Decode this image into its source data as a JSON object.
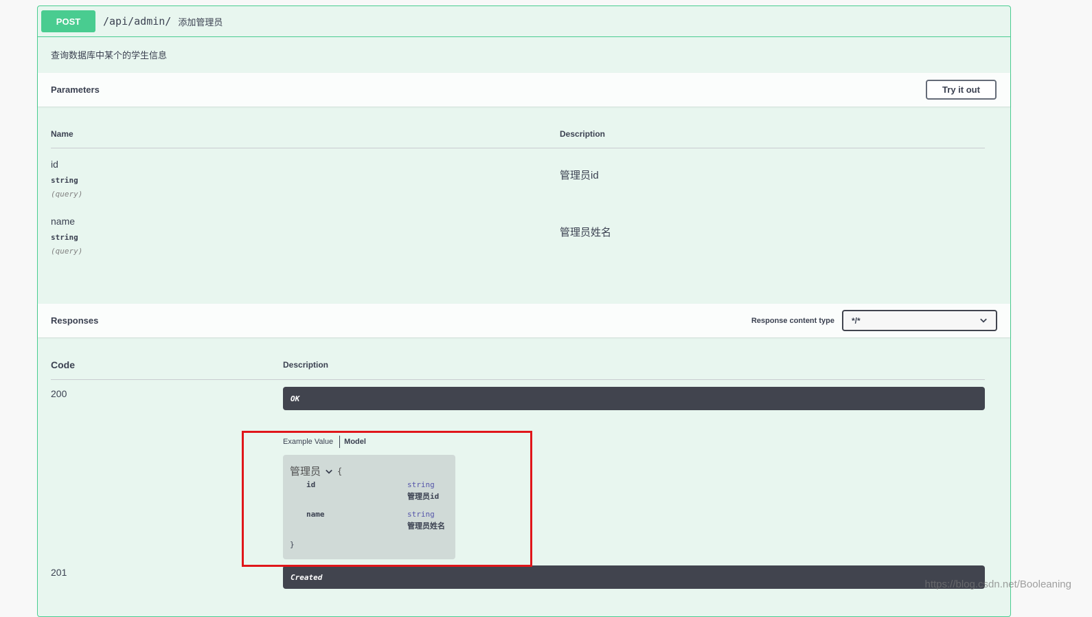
{
  "endpoint": {
    "method": "POST",
    "path": "/api/admin/",
    "summary": "添加管理员",
    "description": "查询数据库中某个的学生信息"
  },
  "parameters": {
    "title": "Parameters",
    "try_button": "Try it out",
    "col_name": "Name",
    "col_description": "Description",
    "items": [
      {
        "name": "id",
        "type": "string",
        "in": "(query)",
        "description": "管理员id"
      },
      {
        "name": "name",
        "type": "string",
        "in": "(query)",
        "description": "管理员姓名"
      }
    ]
  },
  "responses": {
    "title": "Responses",
    "content_type_label": "Response content type",
    "content_type_value": "*/*",
    "col_code": "Code",
    "col_description": "Description",
    "items": [
      {
        "code": "200",
        "description": "OK"
      },
      {
        "code": "201",
        "description": "Created"
      }
    ],
    "tabs": {
      "example": "Example Value",
      "model": "Model"
    },
    "model": {
      "title": "管理员",
      "open_brace": "{",
      "close_brace": "}",
      "props": [
        {
          "name": "id",
          "type": "string",
          "description": "管理员id"
        },
        {
          "name": "name",
          "type": "string",
          "description": "管理员姓名"
        }
      ]
    }
  },
  "watermark": "https://blog.csdn.net/Booleaning",
  "colors": {
    "post": "#49cc90",
    "block_bg": "#e8f6ef",
    "response_bar": "#41444e",
    "highlight": "#e0161a"
  }
}
